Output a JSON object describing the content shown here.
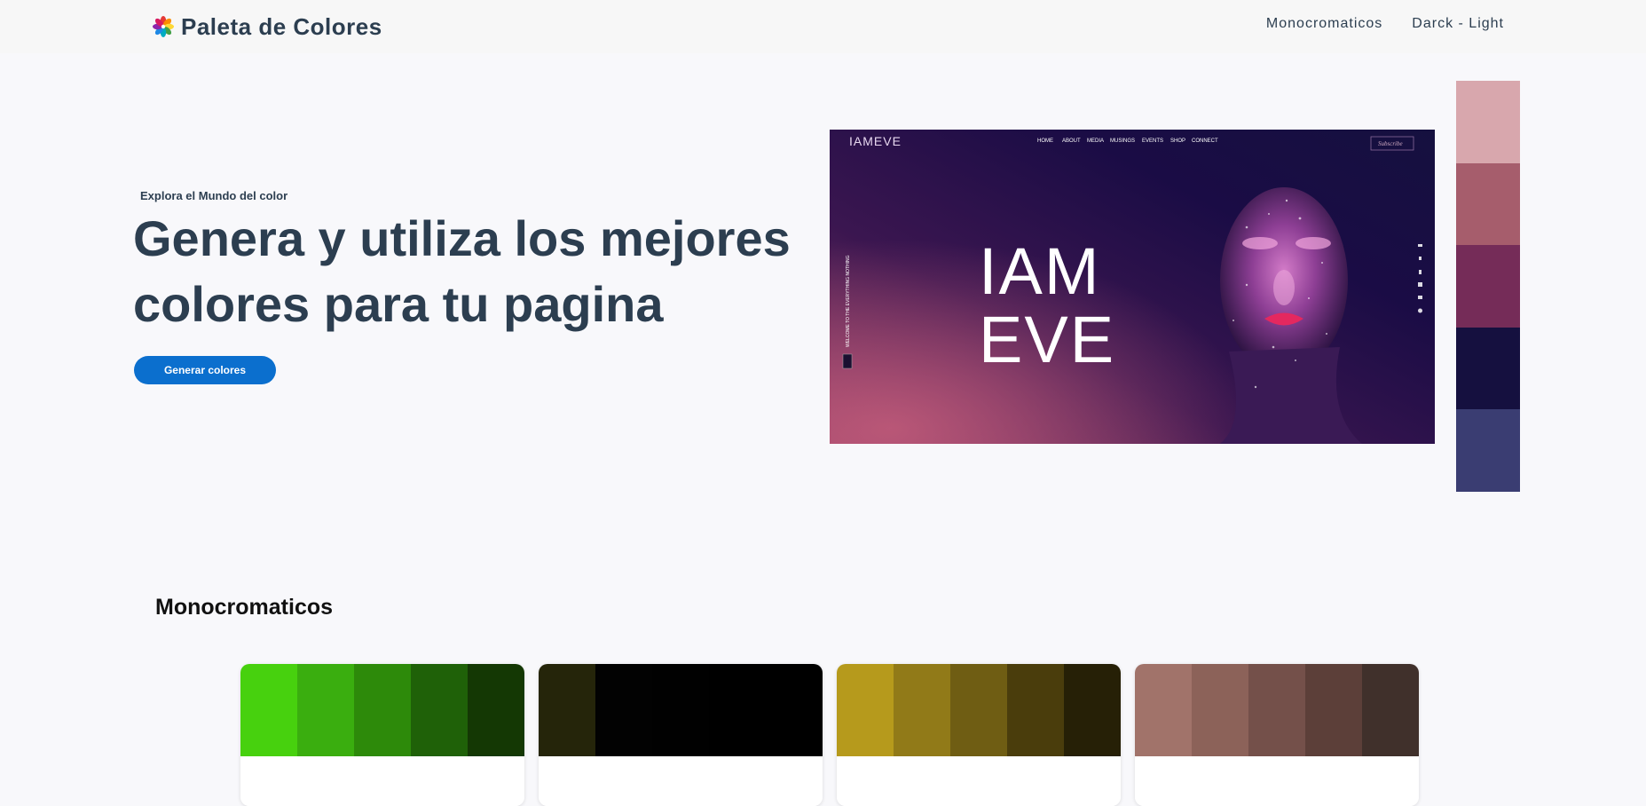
{
  "nav": {
    "brand": "Paleta de Colores",
    "links": [
      "Monocromaticos",
      "Darck - Light"
    ]
  },
  "hero": {
    "eyebrow": "Explora el Mundo del color",
    "heading": "Genera y utiliza los mejores colores para tu pagina",
    "button": "Generar colores",
    "image": {
      "logo": "IAMEVE",
      "menu": [
        "HOME",
        "ABOUT",
        "MEDIA",
        "MUSINGS",
        "EVENTS",
        "SHOP",
        "CONNECT"
      ],
      "subscribe": "Subscribe",
      "title_line1": "IAM",
      "title_line2": "EVE",
      "side_text": "WELCOME TO THE EVERYTHING NOTHING"
    },
    "palette": [
      "#d8a7ad",
      "#a65d6c",
      "#752c58",
      "#15103f",
      "#3a3d72"
    ]
  },
  "monocromaticos": {
    "title": "Monocromaticos",
    "cards": [
      {
        "colors": [
          "#47d10e",
          "#3aae0f",
          "#2d8a0a",
          "#1f6108",
          "#143804"
        ]
      },
      {
        "colors": [
          "#25250a",
          "#020202",
          "#010101",
          "#000000",
          "#000000"
        ]
      },
      {
        "colors": [
          "#b69a1c",
          "#917a18",
          "#6f5d13",
          "#4a3d0c",
          "#262006"
        ]
      },
      {
        "colors": [
          "#a1736a",
          "#8c6259",
          "#74504a",
          "#5c3f39",
          "#40302b"
        ]
      }
    ]
  }
}
